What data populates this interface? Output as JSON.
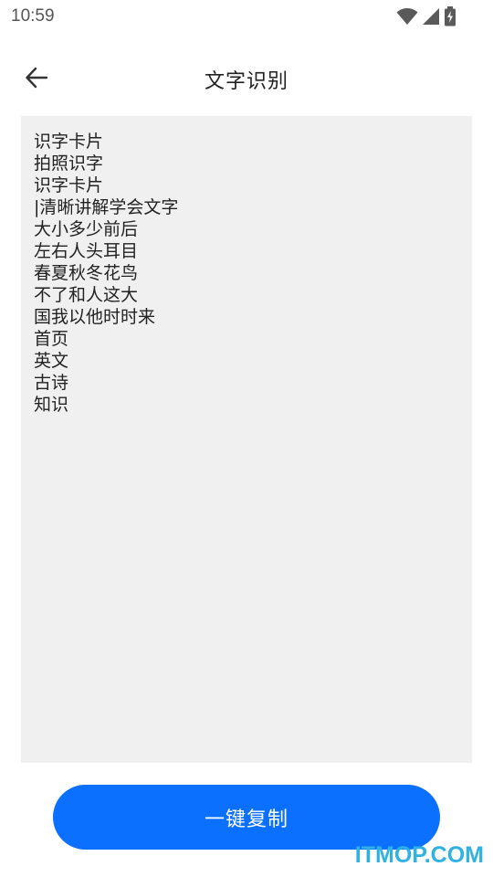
{
  "status_bar": {
    "time": "10:59",
    "icons": [
      "wifi-icon",
      "signal-icon",
      "battery-charging-icon"
    ]
  },
  "app_bar": {
    "back_icon": "arrow-left-icon",
    "title": "文字识别"
  },
  "recognized_text": {
    "lines": [
      "识字卡片",
      "拍照识字",
      "识字卡片",
      "|清晰讲解学会文字",
      "大小多少前后",
      "左右人头耳目",
      "春夏秋冬花鸟",
      "不了和人这大",
      "国我以他时时来",
      "首页",
      "英文",
      "古诗",
      "知识"
    ]
  },
  "actions": {
    "copy_label": "一键复制"
  },
  "watermark": "ITMOP.COM",
  "colors": {
    "primary": "#0c70ff",
    "text_area_bg": "#f0f0f0",
    "watermark": "#2fb2e3"
  }
}
